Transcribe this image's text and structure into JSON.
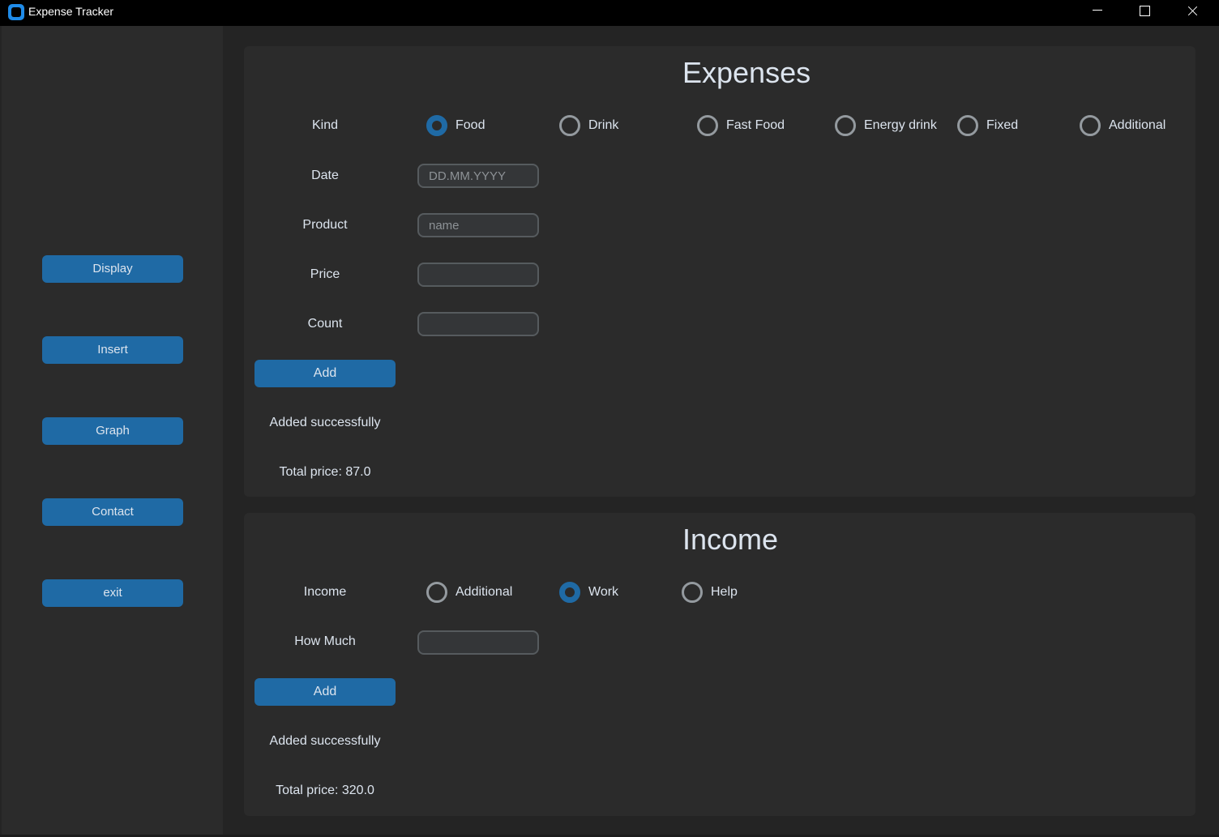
{
  "window": {
    "title": "Expense Tracker"
  },
  "sidebar": {
    "buttons": [
      "Display",
      "Insert",
      "Graph",
      "Contact",
      "exit"
    ]
  },
  "expenses": {
    "heading": "Expenses",
    "kind_label": "Kind",
    "kinds": [
      "Food",
      "Drink",
      "Fast Food",
      "Energy drink",
      "Fixed",
      "Additional"
    ],
    "selected_kind": "Food",
    "date_label": "Date",
    "date_placeholder": "DD.MM.YYYY",
    "product_label": "Product",
    "product_placeholder": "name",
    "price_label": "Price",
    "count_label": "Count",
    "add_label": "Add",
    "status": "Added successfully",
    "total": "Total price: 87.0"
  },
  "income": {
    "heading": "Income",
    "income_label": "Income",
    "sources": [
      "Additional",
      "Work",
      "Help"
    ],
    "selected_source": "Work",
    "how_much_label": "How Much",
    "add_label": "Add",
    "status": "Added successfully",
    "total": "Total price: 320.0"
  },
  "colors": {
    "accent": "#1f6aa5",
    "background": "#242424",
    "panel": "#2b2b2b",
    "text": "#dce4ee"
  }
}
